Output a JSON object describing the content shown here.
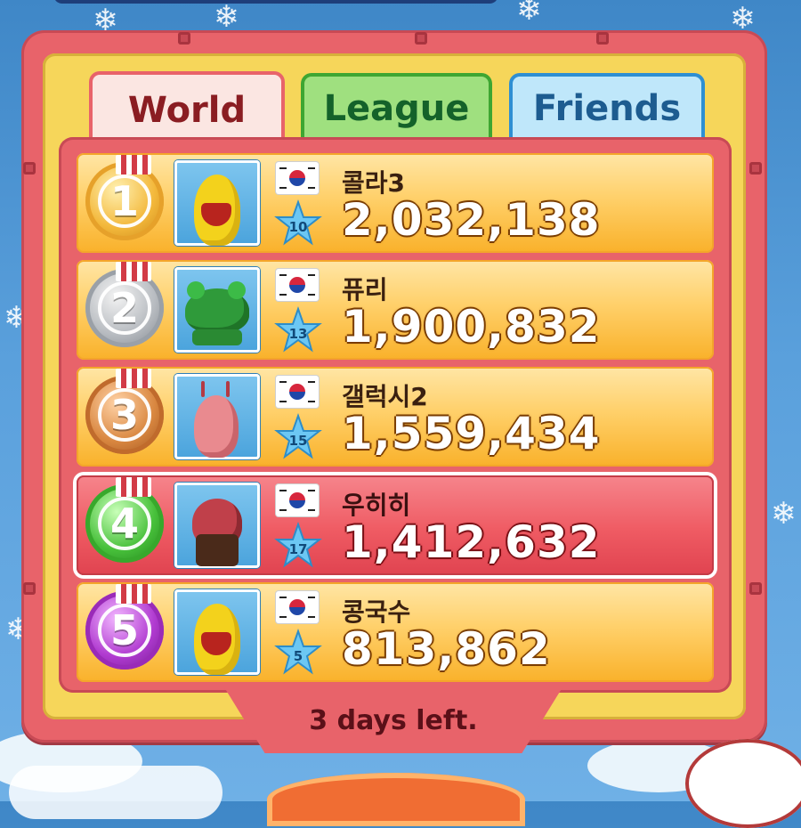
{
  "tabs": [
    {
      "label": "World",
      "active": true
    },
    {
      "label": "League",
      "active": false
    },
    {
      "label": "Friends",
      "active": false
    }
  ],
  "rows": [
    {
      "rank": "1",
      "medal_color": "gold",
      "name": "콜라3",
      "level": "10",
      "score": "2,032,138",
      "avatar": "yellow-larva-icon",
      "flag": "korea-flag-icon",
      "highlight": false
    },
    {
      "rank": "2",
      "medal_color": "silver",
      "name": "퓨리",
      "level": "13",
      "score": "1,900,832",
      "avatar": "green-frog-icon",
      "flag": "korea-flag-icon",
      "highlight": false
    },
    {
      "rank": "3",
      "medal_color": "bronze",
      "name": "갤럭시2",
      "level": "15",
      "score": "1,559,434",
      "avatar": "pink-larva-icon",
      "flag": "korea-flag-icon",
      "highlight": false
    },
    {
      "rank": "4",
      "medal_color": "green",
      "name": "우히히",
      "level": "17",
      "score": "1,412,632",
      "avatar": "red-character-icon",
      "flag": "korea-flag-icon",
      "highlight": true
    },
    {
      "rank": "5",
      "medal_color": "purple",
      "name": "콩국수",
      "level": "5",
      "score": "813,862",
      "avatar": "yellow-larva-icon",
      "flag": "korea-flag-icon",
      "highlight": false
    }
  ],
  "footer": {
    "text": "3 days left."
  },
  "colors": {
    "frame": "#e8636a",
    "tab_world": "#fbe6e2",
    "tab_league": "#9fe07f",
    "tab_friends": "#bfe7fa",
    "row": "#ffd06a",
    "row_highlight": "#ef5b63"
  }
}
